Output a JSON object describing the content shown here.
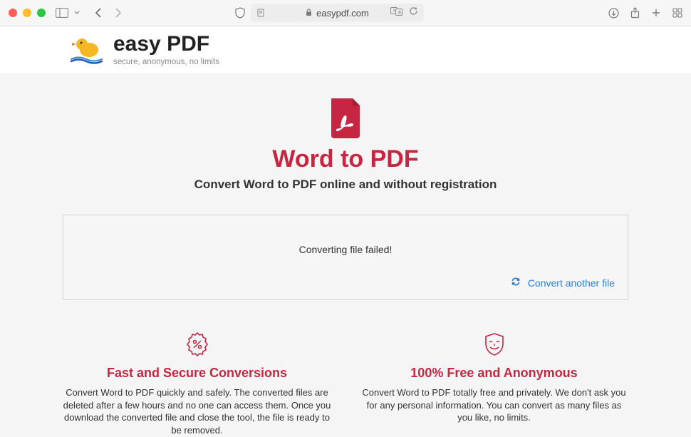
{
  "browser": {
    "url_display": "easypdf.com"
  },
  "brand": {
    "title": "easy PDF",
    "tagline": "secure, anonymous, no limits"
  },
  "hero": {
    "title": "Word to PDF",
    "subtitle": "Convert Word to PDF online and without registration"
  },
  "convert": {
    "message": "Converting file failed!",
    "link_label": "Convert another file"
  },
  "features": [
    {
      "title": "Fast and Secure Conversions",
      "desc": "Convert Word to PDF quickly and safely. The converted files are deleted after a few hours and no one can access them. Once you download the converted file and close the tool, the file is ready to be removed."
    },
    {
      "title": "100% Free and Anonymous",
      "desc": "Convert Word to PDF totally free and privately. We don't ask you for any personal information. You can convert as many files as you like, no limits."
    }
  ],
  "colors": {
    "accent": "#c62641",
    "link": "#2a7de1"
  }
}
